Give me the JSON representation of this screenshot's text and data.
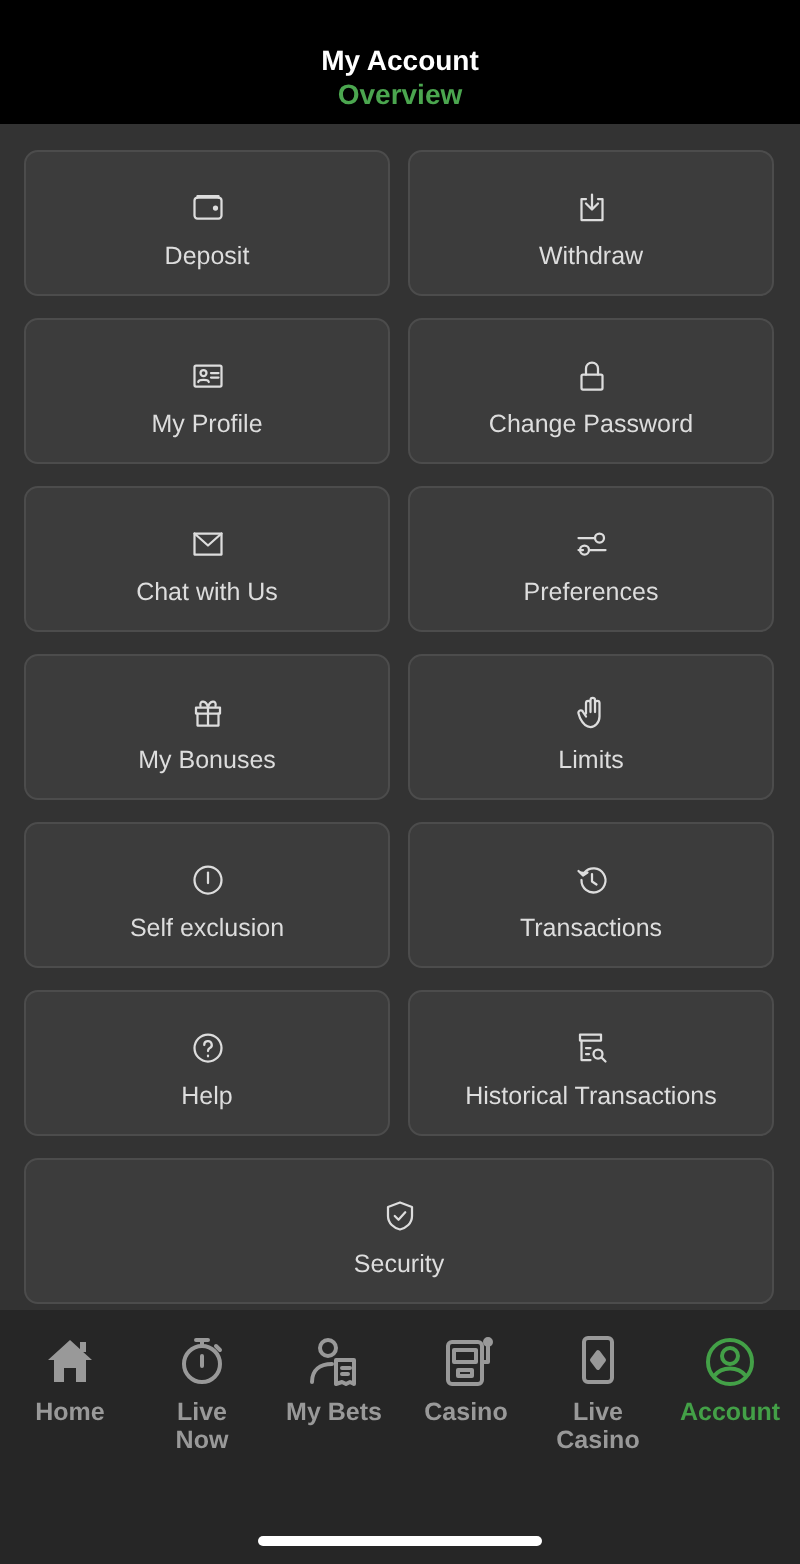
{
  "header": {
    "title": "My Account",
    "subtitle": "Overview"
  },
  "tiles": [
    {
      "label": "Deposit"
    },
    {
      "label": "Withdraw"
    },
    {
      "label": "My Profile"
    },
    {
      "label": "Change Password"
    },
    {
      "label": "Chat with Us"
    },
    {
      "label": "Preferences"
    },
    {
      "label": "My Bonuses"
    },
    {
      "label": "Limits"
    },
    {
      "label": "Self exclusion"
    },
    {
      "label": "Transactions"
    },
    {
      "label": "Help"
    },
    {
      "label": "Historical Transactions"
    },
    {
      "label": "Security"
    }
  ],
  "tab_bar": [
    {
      "label": "Home",
      "selected": false
    },
    {
      "label": "Live Now",
      "selected": false
    },
    {
      "label": "My Bets",
      "selected": false
    },
    {
      "label": "Casino",
      "selected": false
    },
    {
      "label": "Live Casino",
      "selected": false
    },
    {
      "label": "Account",
      "selected": true
    }
  ]
}
